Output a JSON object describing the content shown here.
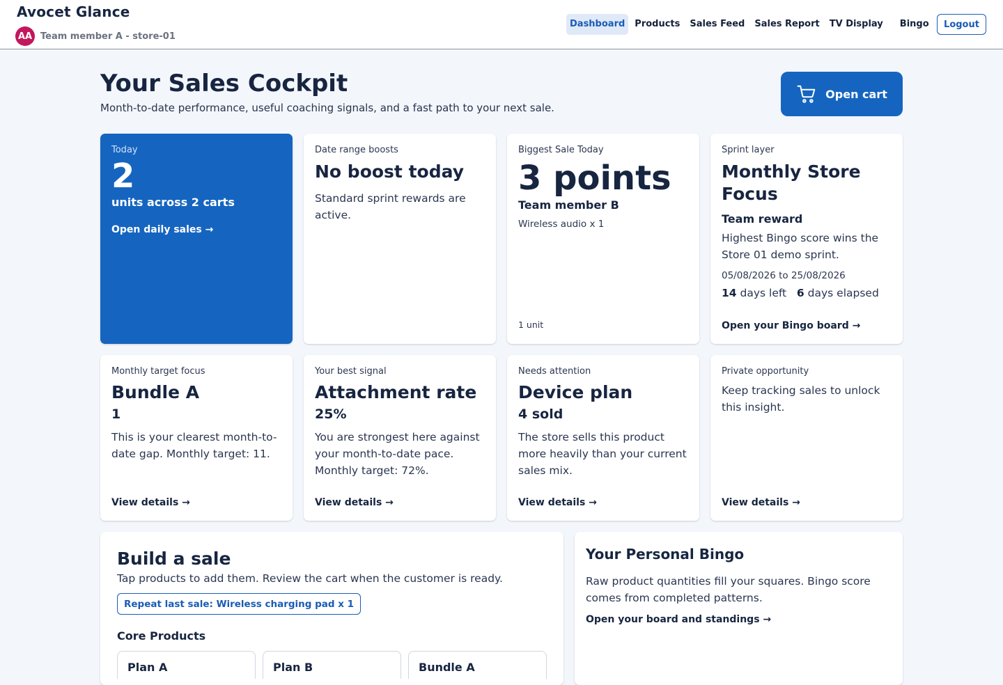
{
  "header": {
    "brand": "Avocet Glance",
    "avatar_initials": "AA",
    "user_line": "Team member A - store-01",
    "nav": [
      "Dashboard",
      "Products",
      "Sales Feed",
      "Sales Report",
      "TV Display",
      "Bingo"
    ],
    "active_nav": "Dashboard",
    "logout_label": "Logout"
  },
  "hero": {
    "title": "Your Sales Cockpit",
    "subtitle": "Month-to-date performance, useful coaching signals, and a fast path to your next sale.",
    "cart_button": "Open cart"
  },
  "cards": {
    "today": {
      "label": "Today",
      "value": "2",
      "units": "units across 2 carts",
      "link": "Open daily sales →"
    },
    "boosts": {
      "label": "Date range boosts",
      "head": "No boost today",
      "body": "Standard sprint rewards are active."
    },
    "biggest": {
      "label": "Biggest Sale Today",
      "points": "3 points",
      "who": "Team member B",
      "what": "Wireless audio x 1",
      "units": "1 unit"
    },
    "sprint": {
      "label": "Sprint layer",
      "head": "Monthly Store Focus",
      "reward": "Team reward",
      "desc": "Highest Bingo score wins the Store 01 demo sprint.",
      "dates": "05/08/2026 to 25/08/2026",
      "days_left_num": "14",
      "days_left_text": "days left",
      "days_elapsed_num": "6",
      "days_elapsed_text": "days elapsed",
      "link": "Open your Bingo board →"
    },
    "target": {
      "label": "Monthly target focus",
      "head": "Bundle A",
      "metric": "1",
      "body": "This is your clearest month-to-date gap. Monthly target: 11.",
      "link": "View details →"
    },
    "signal": {
      "label": "Your best signal",
      "head": "Attachment rate",
      "metric": "25%",
      "body": "You are strongest here against your month-to-date pace. Monthly target: 72%.",
      "link": "View details →"
    },
    "attention": {
      "label": "Needs attention",
      "head": "Device plan",
      "metric": "4 sold",
      "body": "The store sells this product more heavily than your current sales mix.",
      "link": "View details →"
    },
    "private": {
      "label": "Private opportunity",
      "body": "Keep tracking sales to unlock this insight.",
      "link": "View details →"
    }
  },
  "build": {
    "title": "Build a sale",
    "subtitle": "Tap products to add them. Review the cart when the customer is ready.",
    "repeat_button": "Repeat last sale: Wireless charging pad x 1",
    "core_title": "Core Products",
    "products": [
      "Plan A",
      "Plan B",
      "Bundle A"
    ]
  },
  "bingo": {
    "title": "Your Personal Bingo",
    "desc": "Raw product quantities fill your squares. Bingo score comes from completed patterns.",
    "link": "Open your board and standings →"
  },
  "colors": {
    "primary": "#1565c0",
    "avatar": "#c2185b",
    "text": "#172540",
    "background": "#f3f6fb"
  },
  "icons": {
    "cart": "cart-icon"
  }
}
